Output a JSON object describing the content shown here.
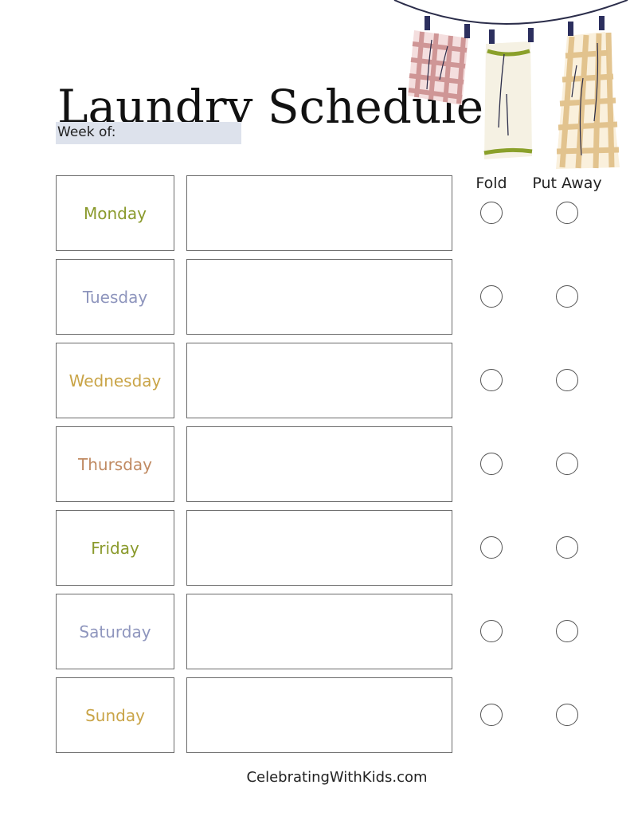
{
  "header": {
    "title": "Laundry Schedule",
    "week_label": "Week of:",
    "week_value": ""
  },
  "columns": {
    "fold": "Fold",
    "put_away": "Put Away"
  },
  "days": [
    {
      "label": "Monday",
      "color": "#8a9a2c",
      "fold": false,
      "put_away": false,
      "entry": ""
    },
    {
      "label": "Tuesday",
      "color": "#8e95bd",
      "fold": false,
      "put_away": false,
      "entry": ""
    },
    {
      "label": "Wednesday",
      "color": "#c9a447",
      "fold": false,
      "put_away": false,
      "entry": ""
    },
    {
      "label": "Thursday",
      "color": "#c08a62",
      "fold": false,
      "put_away": false,
      "entry": ""
    },
    {
      "label": "Friday",
      "color": "#8a9a2c",
      "fold": false,
      "put_away": false,
      "entry": ""
    },
    {
      "label": "Saturday",
      "color": "#8e95bd",
      "fold": false,
      "put_away": false,
      "entry": ""
    },
    {
      "label": "Sunday",
      "color": "#c9a447",
      "fold": false,
      "put_away": false,
      "entry": ""
    }
  ],
  "illustration": {
    "name": "clothesline-with-towels",
    "colors": {
      "line": "#2b2d4a",
      "pin": "#2c2f5e",
      "red_check": "#c98a8a",
      "green_stripe": "#8aa02a",
      "tan_check": "#e0bf86",
      "cream": "#f5f1e3"
    }
  },
  "footer": {
    "site": "CelebratingWithKids.com"
  }
}
